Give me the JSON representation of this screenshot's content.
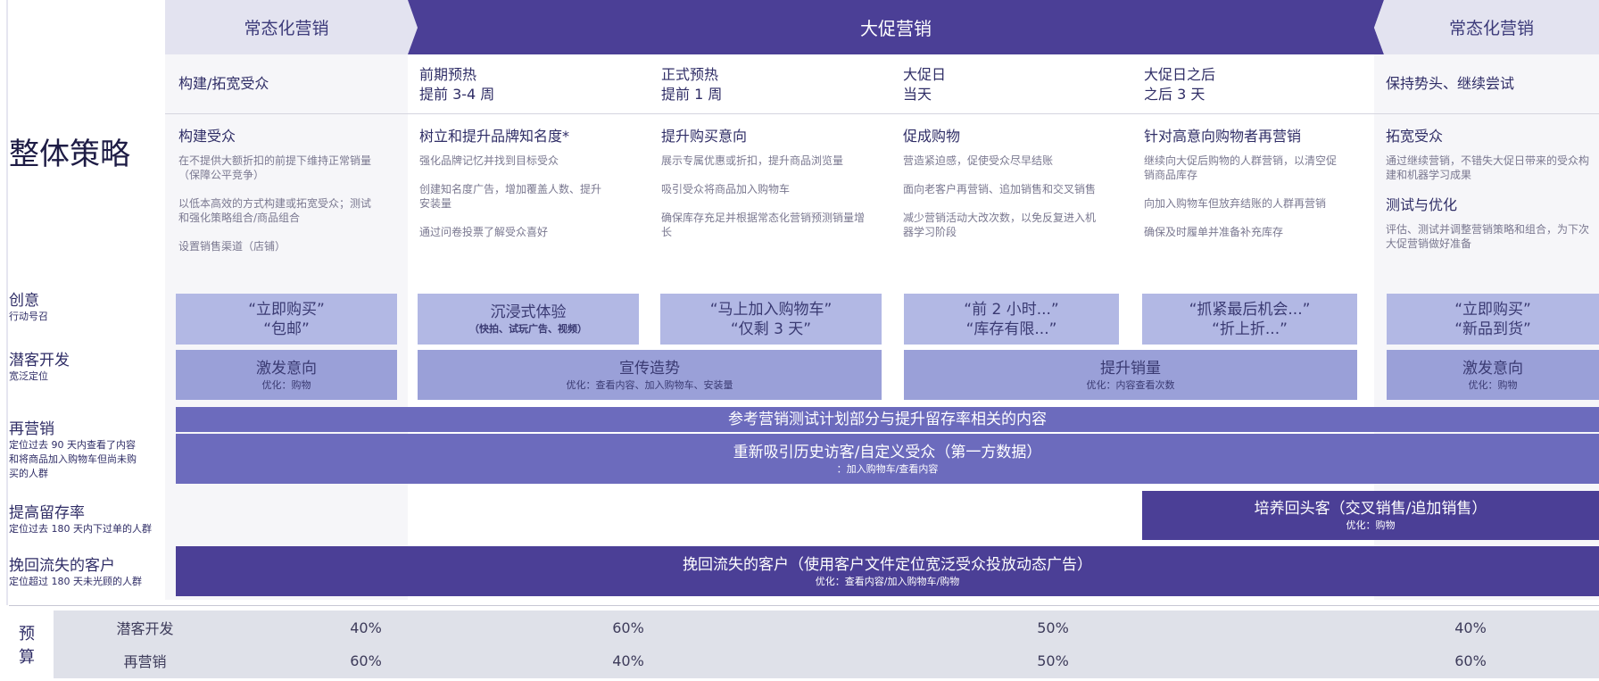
{
  "header": {
    "left_tab": "常态化营销",
    "middle": "大促营销",
    "right_tab": "常态化营销"
  },
  "phases": [
    {
      "line1": "构建/拓宽受众",
      "line2": ""
    },
    {
      "line1": "前期预热",
      "line2": "提前 3-4 周"
    },
    {
      "line1": "正式预热",
      "line2": "提前 1 周"
    },
    {
      "line1": "大促日",
      "line2": "当天"
    },
    {
      "line1": "大促日之后",
      "line2": "之后 3 天"
    },
    {
      "line1": "保持势头、继续尝试",
      "line2": ""
    }
  ],
  "overall_strategy": "整体策略",
  "strategies": [
    {
      "title": "构建受众",
      "items": [
        "在不提供大额折扣的前提下维持正常销量（保障公平竞争）",
        "以低本高效的方式构建或拓宽受众；测试和强化策略组合/商品组合",
        "设置销售渠道（店铺）"
      ]
    },
    {
      "title": "树立和提升品牌知名度*",
      "items": [
        "强化品牌记忆并找到目标受众",
        "创建知名度广告，增加覆盖人数、提升安装量",
        "通过问卷投票了解受众喜好"
      ]
    },
    {
      "title": "提升购买意向",
      "items": [
        "展示专属优惠或折扣，提升商品浏览量",
        "吸引受众将商品加入购物车",
        "确保库存充足并根据常态化营销预测销量增长"
      ]
    },
    {
      "title": "促成购物",
      "items": [
        "营造紧迫感，促使受众尽早结账",
        "面向老客户再营销、追加销售和交叉销售",
        "减少营销活动大改次数，以免反复进入机器学习阶段"
      ]
    },
    {
      "title": "针对高意向购物者再营销",
      "items": [
        "继续向大促后购物的人群营销，以清空促销商品库存",
        "向加入购物车但放弃结账的人群再营销",
        "确保及时履单并准备补充库存"
      ]
    },
    {
      "title": "拓宽受众",
      "items": [
        "通过继续营销，不错失大促日带来的受众构建和机器学习成果"
      ],
      "title2": "测试与优化",
      "items2": [
        "评估、测试并调整营销策略和组合，为下次大促营销做好准备"
      ]
    }
  ],
  "rows": {
    "creative": {
      "label": "创意",
      "sub": "行动号召"
    },
    "prospecting": {
      "label": "潜客开发",
      "sub": "宽泛定位"
    },
    "remarketing": {
      "label": "再营销",
      "sub": "定位过去 90 天内查看了内容和将商品加入购物车但尚未购买的人群"
    },
    "retention": {
      "label": "提高留存率",
      "sub": "定位过去 180 天内下过单的人群"
    },
    "winback": {
      "label": "挽回流失的客户",
      "sub": "定位超过 180 天未光顾的人群"
    }
  },
  "creative_boxes": [
    {
      "l1": "“立即购买”",
      "l2": "“包邮”"
    },
    {
      "l1": "沉浸式体验",
      "l2": "（快拍、试玩广告、视频）"
    },
    {
      "l1": "“马上加入购物车”",
      "l2": "“仅剩 3 天”"
    },
    {
      "l1": "“前 2 小时...”",
      "l2": "“库存有限...”"
    },
    {
      "l1": "“抓紧最后机会...”",
      "l2": "“折上折...”"
    },
    {
      "l1": "“立即购买”",
      "l2": "“新品到货”"
    }
  ],
  "prospecting_boxes": [
    {
      "main": "激发意向",
      "sub": "优化：购物"
    },
    {
      "main": "宣传造势",
      "sub": "优化：查看内容、加入购物车、安装量"
    },
    {
      "main": "提升销量",
      "sub": "优化：内容查看次数"
    },
    {
      "main": "激发意向",
      "sub": "优化：购物"
    }
  ],
  "remarketing_boxes": {
    "top": "参考营销测试计划部分与提升留存率相关的内容",
    "main": "重新吸引历史访客/自定义受众（第一方数据）",
    "sub": "：加入购物车/查看内容"
  },
  "retention_box": {
    "main": "培养回头客（交叉销售/追加销售）",
    "sub": "优化：购物"
  },
  "winback_box": {
    "main": "挽回流失的客户（使用客户文件定位宽泛受众投放动态广告）",
    "sub": "优化：查看内容/加入购物车/购物"
  },
  "budget": {
    "label_top": "预",
    "label_bottom": "算",
    "row1_label": "潜客开发",
    "row2_label": "再营销",
    "row1": [
      "40%",
      "60%",
      "50%",
      "40%"
    ],
    "row2": [
      "60%",
      "40%",
      "50%",
      "60%"
    ]
  },
  "colors": {
    "dark_purple": "#4b3f96",
    "mid_purple": "#6c6bbd",
    "light_box": "#b2b8e4",
    "prospect_box": "#9aa0d8",
    "budget_bg": "#dfe1e9"
  }
}
